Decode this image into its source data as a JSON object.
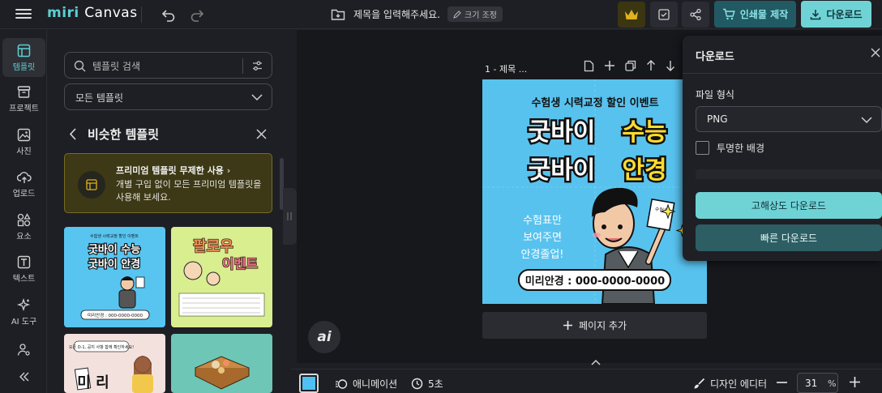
{
  "header": {
    "logo_main": "miri",
    "logo_sub": "Canvas",
    "doc_title": "제목을 입력해주세요.",
    "resize_label": "크기 조정",
    "print_label": "인쇄물 제작",
    "download_label": "다운로드",
    "accent_color": "#6fd3d6"
  },
  "rail": {
    "items": [
      {
        "label": "템플릿",
        "icon": "template-icon"
      },
      {
        "label": "프로젝트",
        "icon": "project-icon"
      },
      {
        "label": "사진",
        "icon": "photo-icon"
      },
      {
        "label": "업로드",
        "icon": "upload-icon"
      },
      {
        "label": "요소",
        "icon": "elements-icon"
      },
      {
        "label": "텍스트",
        "icon": "text-icon"
      },
      {
        "label": "AI 도구",
        "icon": "ai-tools-icon"
      }
    ]
  },
  "panel": {
    "search_placeholder": "템플릿 검색",
    "category_value": "모든 템플릿",
    "similar_title": "비슷한 템플릿",
    "promo_title": "프리미엄 템플릿 무제한 사용",
    "promo_desc": "개별 구입 없이 모든 프리미엄 템플릿을 사용해 보세요."
  },
  "thumbs": {
    "t1": {
      "line1": "수험생 시력교정 할인 이벤트",
      "line2": "굿바이 수능",
      "line3": "굿바이 안경",
      "phone": "미리안경 : 000-0000-0000"
    },
    "t2": {
      "line1": "팔로우",
      "line2": "이벤트"
    },
    "t3": {
      "line1": "오픈 D-1, 공지 사항 함께 확인하세요!",
      "line2": "미 리"
    }
  },
  "canvas": {
    "page_label": "1 - 제목 ...",
    "design": {
      "subtitle": "수험생 시력교정 할인 이벤트",
      "line1_a": "굿바이",
      "line1_b": "수능",
      "line2_a": "굿바이",
      "line2_b": "안경",
      "side_text_1": "수험표만",
      "side_text_2": "보여주면",
      "side_text_3": "안경졸업!",
      "card_text": "수험표",
      "phone": "미리안경 : 000-0000-0000"
    },
    "add_page_label": "페이지 추가",
    "ai_label": "ai"
  },
  "download_panel": {
    "title": "다운로드",
    "file_format_label": "파일 형식",
    "file_format_value": "PNG",
    "transparent_label": "투명한 배경",
    "hq_label": "고해상도 다운로드",
    "fast_label": "빠른 다운로드"
  },
  "bottombar": {
    "animation_label": "애니메이션",
    "duration_label": "5초",
    "design_editor_label": "디자인 에디터",
    "zoom_value": "31",
    "zoom_unit": "%",
    "swatch_color": "#4fc0f2"
  }
}
